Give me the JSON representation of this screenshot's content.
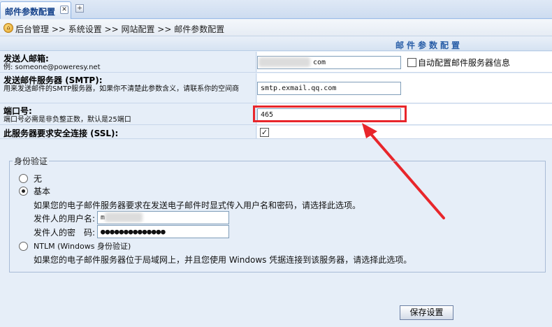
{
  "tab": {
    "label": "邮件参数配置",
    "close_glyph": "✕",
    "new_glyph": "+"
  },
  "breadcrumb": {
    "icon_glyph": "⌂",
    "text": "后台管理 >> 系统设置 >> 网站配置 >> 邮件参数配置"
  },
  "section_title": "邮件参数配置",
  "sender_email": {
    "title": "发送人邮箱:",
    "desc": "例: someone@poweresy.net",
    "value": "com",
    "auto_config_label": "自动配置邮件服务器信息",
    "auto_config_checked": false
  },
  "smtp_server": {
    "title": "发送邮件服务器 (SMTP):",
    "desc": "用来发送邮件的SMTP服务器，如果你不清楚此参数含义，请联系你的空间商",
    "value": "smtp.exmail.qq.com"
  },
  "port": {
    "title": "端口号:",
    "desc": "端口号必需是非负整正数，默认是25端口",
    "value": "465"
  },
  "ssl": {
    "title": "此服务器要求安全连接 (SSL):",
    "checked": true,
    "check_glyph": "✓"
  },
  "auth": {
    "legend": "身份验证",
    "none_label": "无",
    "basic_label": "基本",
    "basic_desc": "如果您的电子邮件服务器要求在发送电子邮件时显式传入用户名和密码，请选择此选项。",
    "username_label": "发件人的用户名:",
    "username_value": "m",
    "password_label": "发件人的密　码:",
    "password_value": "●●●●●●●●●●●●●●",
    "ntlm_label": "NTLM (Windows 身份验证)",
    "ntlm_desc": "如果您的电子邮件服务器位于局域网上，并且您使用 Windows 凭据连接到该服务器，请选择此选项。",
    "selected": "basic"
  },
  "save_button": "保存设置",
  "colors": {
    "annotation_red": "#e8262b",
    "section_title": "#2a5fa8"
  }
}
